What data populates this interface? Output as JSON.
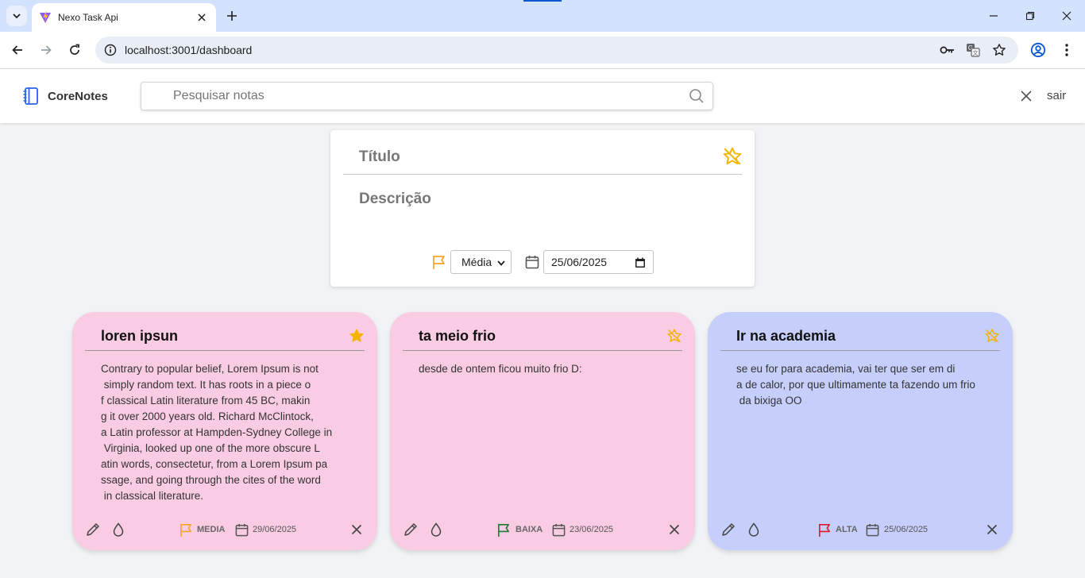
{
  "browser": {
    "tab_title": "Nexo Task Api",
    "url": "localhost:3001/dashboard"
  },
  "header": {
    "brand": "CoreNotes",
    "search_placeholder": "Pesquisar notas",
    "logout_label": "sair"
  },
  "create_form": {
    "title_placeholder": "Título",
    "description_placeholder": "Descrição",
    "priority_value": "Média",
    "date_value": "25/06/2025"
  },
  "notes": [
    {
      "title": "loren ipsun",
      "body": "Contrary to popular belief, Lorem Ipsum is not\n simply random text. It has roots in a piece o\nf classical Latin literature from 45 BC, makin\ng it over 2000 years old. Richard McClintock,\na Latin professor at Hampden-Sydney College in\n Virginia, looked up one of the more obscure L\natin words, consectetur, from a Lorem Ipsum pa\nssage, and going through the cites of the word\n in classical literature.",
      "priority": "MEDIA",
      "date": "29/06/2025",
      "favorite": true,
      "bg_color": "#f9cce4",
      "flag_color": "#f5a623"
    },
    {
      "title": "ta meio frio",
      "body": "desde de ontem ficou muito frio D:",
      "priority": "BAIXA",
      "date": "23/06/2025",
      "favorite": false,
      "bg_color": "#f9cce4",
      "flag_color": "#1e7a2e"
    },
    {
      "title": "Ir na academia",
      "body": "se eu for para academia, vai ter que ser em di\na de calor, por que ultimamente ta fazendo um frio\n da bixiga OO",
      "priority": "ALTA",
      "date": "25/06/2025",
      "favorite": false,
      "bg_color": "#c6cffb",
      "flag_color": "#e0192a"
    }
  ],
  "colors": {
    "star_accent": "#f4b400",
    "chrome_bg": "#d3e3fd"
  }
}
